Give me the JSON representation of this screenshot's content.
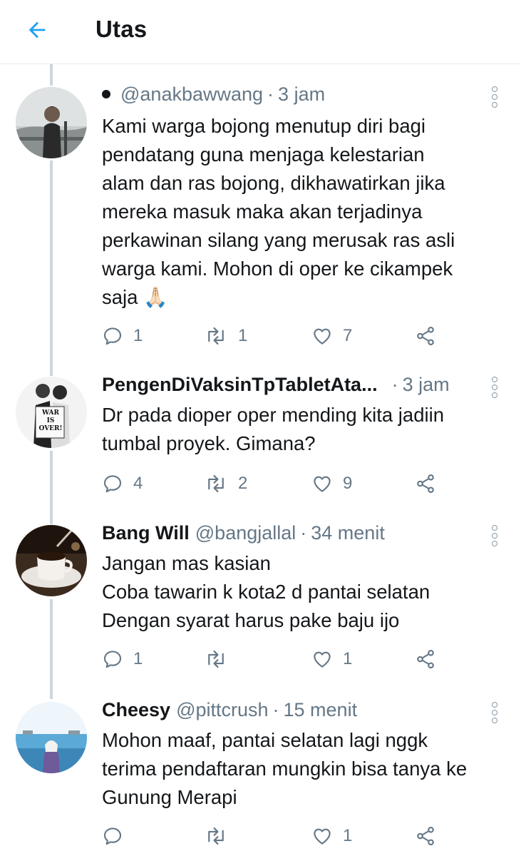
{
  "header": {
    "title": "Utas",
    "back_icon": "arrow-left-icon"
  },
  "colors": {
    "accent": "#1da1f2",
    "muted": "#657786",
    "text": "#14171a",
    "thread_line": "#ccd6dd"
  },
  "tweets": [
    {
      "name": "",
      "handle": "@anakbawwang",
      "time": "3 jam",
      "has_dot": true,
      "lines": [
        "Kami warga bojong menutup diri bagi",
        "pendatang guna menjaga kelestarian",
        "alam dan ras bojong, dikhawatirkan jika",
        "mereka masuk maka akan terjadinya",
        "perkawinan silang yang merusak ras asli",
        "warga kami. Mohon di oper ke cikampek",
        "saja 🙏🏻"
      ],
      "replies": "1",
      "retweets": "1",
      "likes": "7"
    },
    {
      "name": "PengenDiVaksinTpTabletAta...",
      "handle": "",
      "time": "3 jam",
      "avatar_text": [
        "WAR",
        "IS",
        "OVER!"
      ],
      "lines": [
        "Dr pada dioper oper mending kita jadiin",
        "tumbal proyek. Gimana?"
      ],
      "replies": "4",
      "retweets": "2",
      "likes": "9"
    },
    {
      "name": "Bang Will",
      "handle": "@bangjallal",
      "time": "34 menit",
      "lines": [
        "Jangan mas kasian",
        "Coba tawarin k kota2 d pantai selatan",
        "Dengan syarat harus pake baju ijo"
      ],
      "replies": "1",
      "retweets": "",
      "likes": "1"
    },
    {
      "name": "Cheesy",
      "handle": "@pittcrush",
      "time": "15 menit",
      "lines": [
        "Mohon maaf, pantai selatan lagi nggk",
        "terima pendaftaran mungkin bisa tanya ke",
        "Gunung Merapi"
      ],
      "replies": "",
      "retweets": "",
      "likes": "1"
    }
  ]
}
